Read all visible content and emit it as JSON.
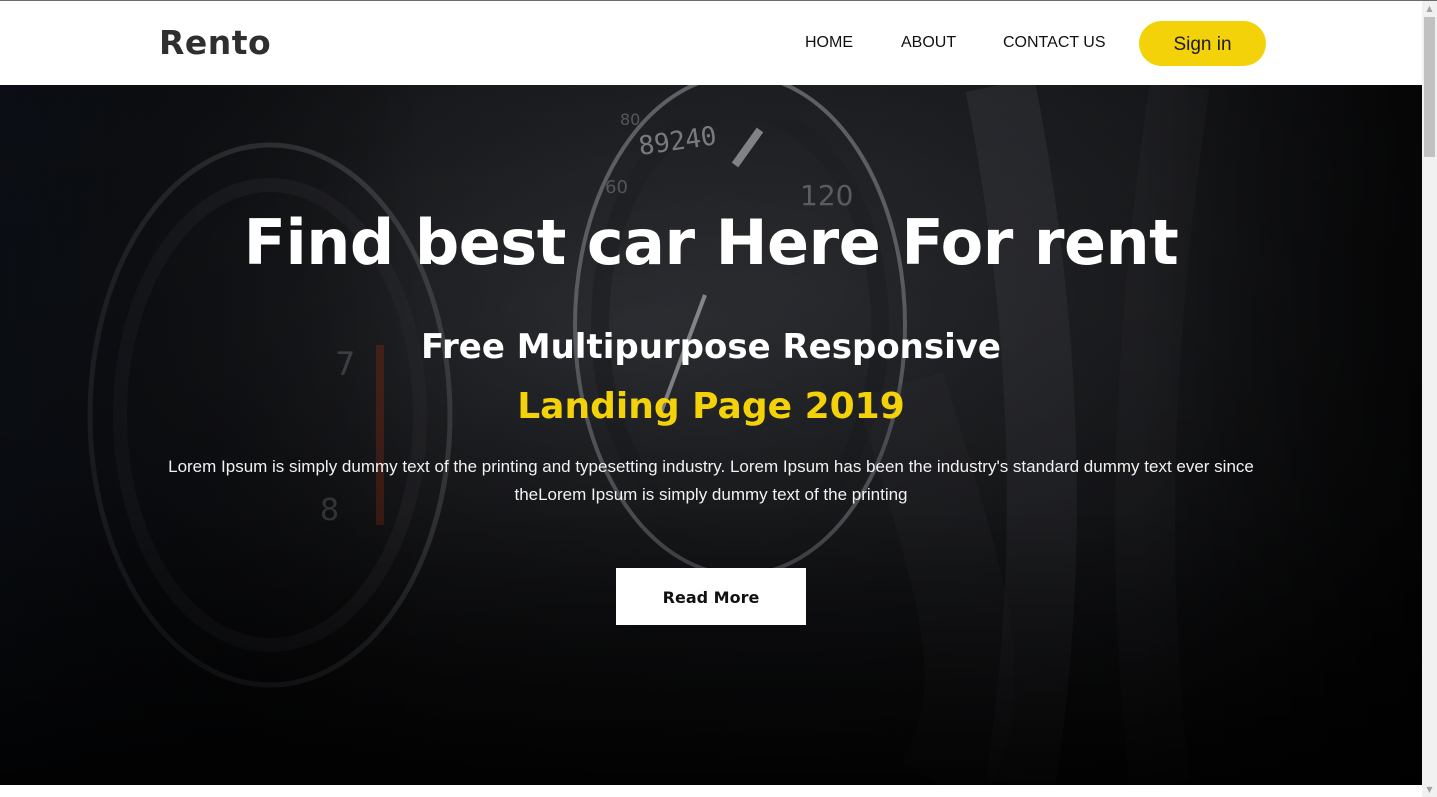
{
  "header": {
    "logo": "Rento",
    "nav": {
      "home": "HOME",
      "about": "ABOUT",
      "contact": "CONTACT US"
    },
    "signin_label": "Sign in"
  },
  "hero": {
    "title": "Find best car Here For rent",
    "subtitle_line1": "Free Multipurpose Responsive",
    "subtitle_line2": "Landing Page 2019",
    "description": "Lorem Ipsum is simply dummy text of the printing and typesetting industry. Lorem Ipsum has been the industry's standard dummy text ever since theLorem Ipsum is simply dummy text of the printing",
    "read_more_label": "Read More",
    "gauge_readout": "89240"
  },
  "colors": {
    "accent": "#f4d20a",
    "hero_bg": "#111215",
    "logo_text": "#2f2f2f"
  },
  "icons": {
    "scroll_up": "scroll-up-arrow-icon",
    "scroll_down": "scroll-down-arrow-icon"
  }
}
